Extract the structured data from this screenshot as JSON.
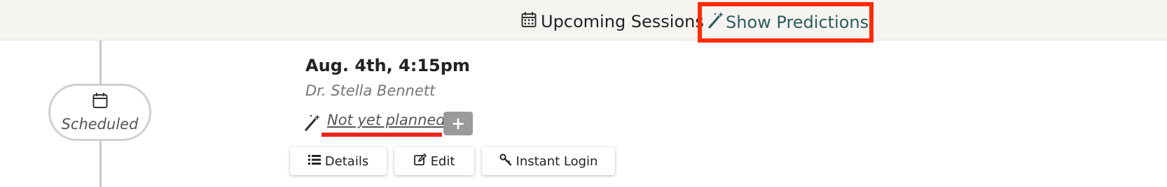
{
  "header": {
    "title": "Upcoming Sessions",
    "predictions_label": "Show Predictions",
    "accent_color": "#2b5d5c",
    "highlight_color": "#ff2a00"
  },
  "session": {
    "status": "Scheduled",
    "date": "Aug. 4th, 4:15pm",
    "provider": "Dr. Stella Bennett",
    "plan_status": "Not yet planned",
    "add_label": "+"
  },
  "actions": {
    "details": "Details",
    "edit": "Edit",
    "instant_login": "Instant Login"
  },
  "icons": [
    "calendar-icon",
    "magic-wand-icon",
    "list-icon",
    "edit-icon",
    "key-icon"
  ]
}
